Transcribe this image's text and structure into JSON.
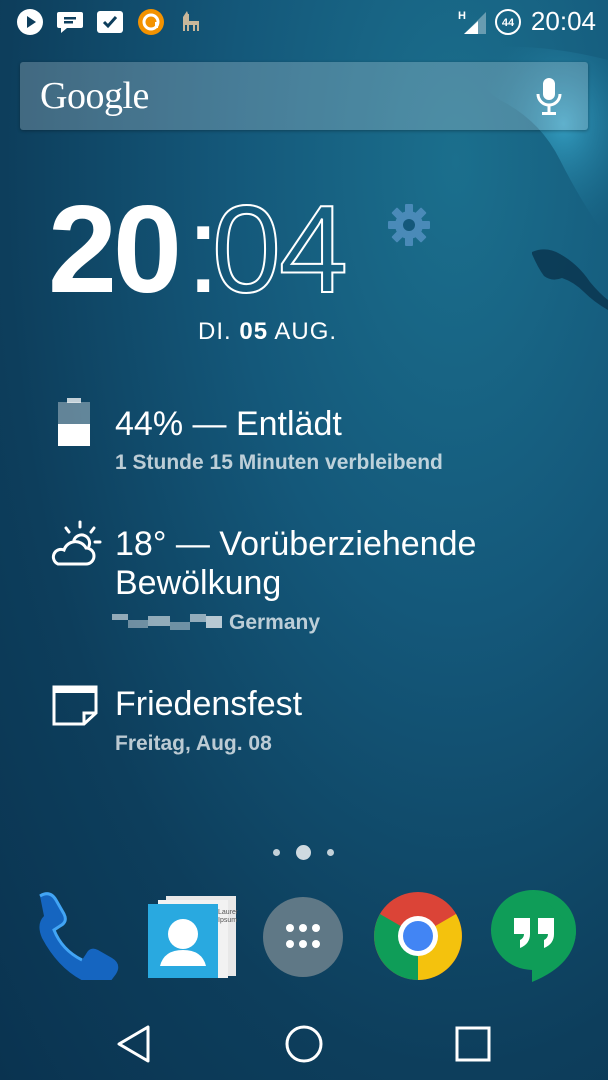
{
  "status_bar": {
    "time": "20:04",
    "battery_level": "44",
    "network_type": "H",
    "notification_icons": [
      "play-icon",
      "message-icon",
      "check-icon",
      "audible-icon",
      "llama-icon"
    ]
  },
  "search": {
    "logo": "Google",
    "icon": "mic-icon"
  },
  "clock": {
    "hours": "20",
    "separator": ":",
    "minutes": "04"
  },
  "date": {
    "weekday": "DI.",
    "day": "05",
    "month": "AUG."
  },
  "battery_widget": {
    "title": "44% — Entlädt",
    "subtitle": "1 Stunde 15 Minuten verbleibend",
    "level": 0.44
  },
  "weather_widget": {
    "title_line1": "18° — Vorüberziehende",
    "title_line2": "Bewölkung",
    "location": "Germany"
  },
  "calendar_widget": {
    "title": "Friedensfest",
    "subtitle": "Freitag, Aug. 08"
  },
  "page_indicator": {
    "pages": 3,
    "current": 2
  },
  "dock": [
    "phone-icon",
    "contacts-icon",
    "app-drawer-icon",
    "chrome-icon",
    "hangouts-icon"
  ],
  "nav_bar": [
    "back-icon",
    "home-icon",
    "recents-icon"
  ],
  "colors": {
    "accent_blue": "#1565c0",
    "hangouts_green": "#0f9d58",
    "gear_blue": "#4a8ab8"
  }
}
